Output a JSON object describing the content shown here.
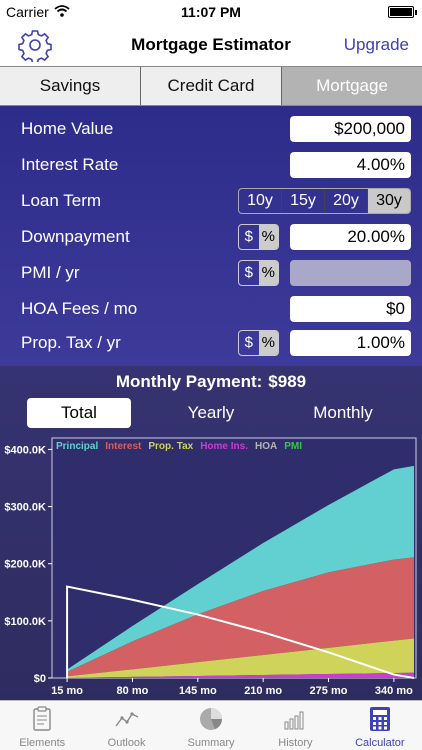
{
  "status_bar": {
    "carrier": "Carrier",
    "time": "11:07 PM"
  },
  "nav": {
    "title": "Mortgage Estimator",
    "upgrade_label": "Upgrade",
    "settings_icon": "gear-icon"
  },
  "segments": [
    {
      "label": "Savings",
      "active": false
    },
    {
      "label": "Credit Card",
      "active": false
    },
    {
      "label": "Mortgage",
      "active": true
    }
  ],
  "form": {
    "home_value": {
      "label": "Home Value",
      "value": "$200,000"
    },
    "interest_rate": {
      "label": "Interest Rate",
      "value": "4.00%"
    },
    "loan_term": {
      "label": "Loan Term",
      "options": [
        "10y",
        "15y",
        "20y",
        "30y"
      ],
      "selected": "30y"
    },
    "downpayment": {
      "label": "Downpayment",
      "value": "20.00%",
      "unit_dollar": "$",
      "unit_percent": "%",
      "unit_selected": "%"
    },
    "pmi": {
      "label": "PMI / yr",
      "value": "",
      "unit_dollar": "$",
      "unit_percent": "%",
      "unit_selected": "%"
    },
    "hoa": {
      "label": "HOA Fees / mo",
      "value": "$0"
    },
    "prop_tax": {
      "label": "Prop. Tax / yr",
      "value": "1.00%",
      "unit_dollar": "$",
      "unit_percent": "%",
      "unit_selected": "%"
    }
  },
  "summary": {
    "monthly_label": "Monthly Payment:",
    "monthly_value": "$989",
    "tabs": [
      {
        "label": "Total",
        "active": true
      },
      {
        "label": "Yearly",
        "active": false
      },
      {
        "label": "Monthly",
        "active": false
      }
    ]
  },
  "tab_bar": [
    {
      "label": "Elements",
      "icon": "clipboard-icon",
      "active": false
    },
    {
      "label": "Outlook",
      "icon": "line-chart-icon",
      "active": false
    },
    {
      "label": "Summary",
      "icon": "pie-chart-icon",
      "active": false
    },
    {
      "label": "History",
      "icon": "bar-chart-icon",
      "active": false
    },
    {
      "label": "Calculator",
      "icon": "calculator-icon",
      "active": true
    }
  ],
  "chart_data": {
    "type": "area",
    "stacked": true,
    "legend_position": "top",
    "x": [
      15,
      80,
      145,
      210,
      275,
      340,
      360
    ],
    "xticks": [
      "15 mo",
      "80 mo",
      "145 mo",
      "210 mo",
      "275 mo",
      "340 mo"
    ],
    "yticks": [
      "$0",
      "$100.0K",
      "$200.0K",
      "$300.0K",
      "$400.0K"
    ],
    "ylim": [
      0,
      420000
    ],
    "xlim": [
      0,
      362
    ],
    "series": [
      {
        "name": "PMI",
        "color": "#3cc24f",
        "values": [
          0,
          0,
          0,
          0,
          0,
          0,
          0
        ]
      },
      {
        "name": "HOA",
        "color": "#b5b5b5",
        "values": [
          0,
          0,
          0,
          0,
          0,
          0,
          0
        ]
      },
      {
        "name": "Home Ins.",
        "color": "#c93dd0",
        "values": [
          300,
          1900,
          3600,
          5300,
          7000,
          8700,
          9200
        ]
      },
      {
        "name": "Prop. Tax",
        "color": "#cfd35a",
        "values": [
          2500,
          13300,
          24200,
          35000,
          45800,
          56700,
          60000
        ]
      },
      {
        "name": "Interest",
        "color": "#d36063",
        "values": [
          8000,
          48800,
          83500,
          112000,
          132000,
          141800,
          142000
        ]
      },
      {
        "name": "Principal",
        "color": "#62cfd0",
        "values": [
          4000,
          27000,
          53000,
          84000,
          118000,
          158000,
          160000
        ]
      }
    ],
    "balance_line": {
      "color": "#ffffff",
      "values": [
        160000,
        137000,
        111000,
        80000,
        45000,
        6000,
        0
      ]
    }
  }
}
